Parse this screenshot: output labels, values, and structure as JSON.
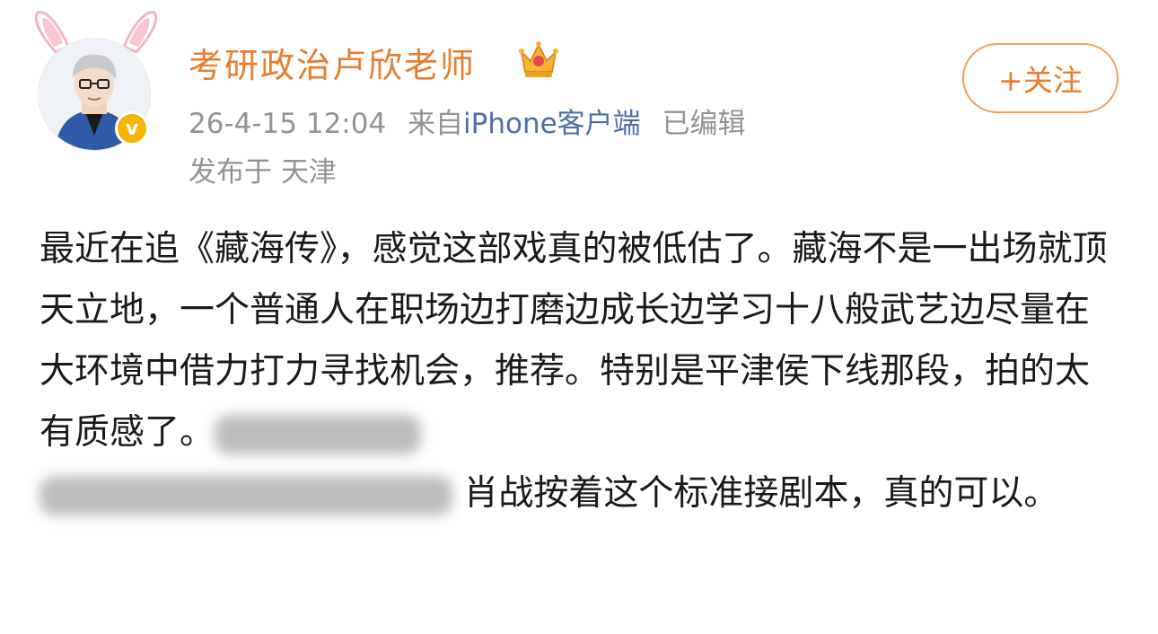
{
  "user": {
    "name": "考研政治卢欣老师",
    "verified_icon": "v-badge-icon",
    "vip_icon": "crown-icon"
  },
  "meta": {
    "time": "26-4-15 12:04",
    "source_prefix": "来自",
    "source_client": "iPhone客户端",
    "edited": "已编辑"
  },
  "location": "发布于 天津",
  "follow_button": "+关注",
  "post": {
    "text_before_blur": "最近在追《藏海传》，感觉这部戏真的被低估了。藏海不是一出场就顶天立地，一个普通人在职场边打磨边成长边学习十八般武艺边尽量在大环境中借力打力寻找机会，推荐。特别是平津侯下线那段，拍的太有质感了。",
    "text_after_blur": "肖战按着这个标准接剧本，真的可以。"
  },
  "colors": {
    "username": "#e87d2f",
    "meta_gray": "#939393",
    "client_blue": "#4a6fa8",
    "follow_border": "#f0a15c",
    "body_text": "#1a1a1a"
  }
}
